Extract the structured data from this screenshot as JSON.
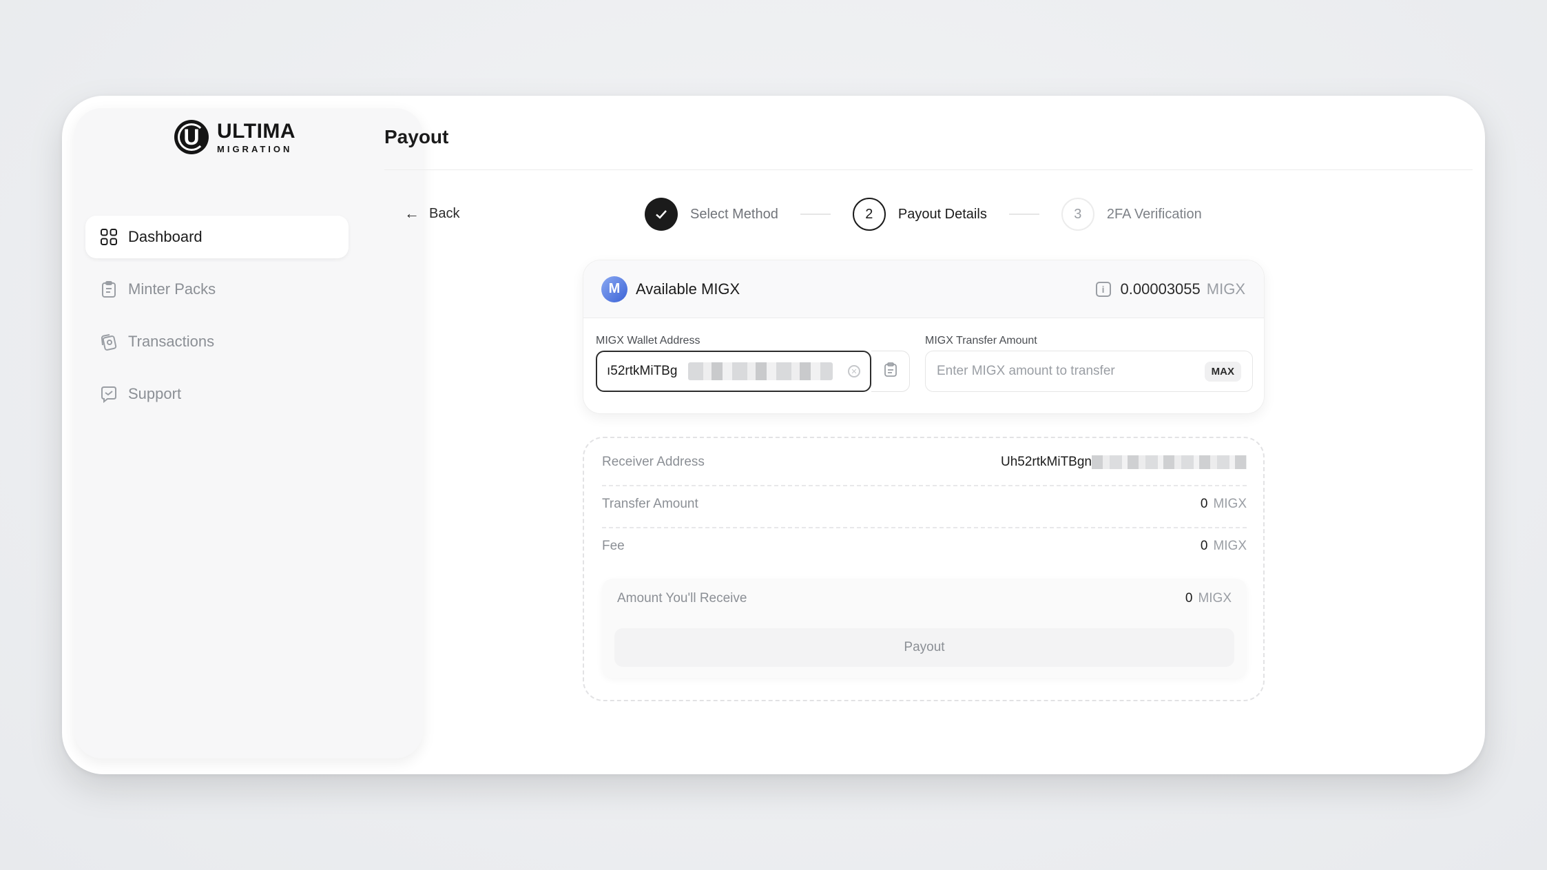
{
  "brand": {
    "title": "ULTIMA",
    "subtitle": "MIGRATION",
    "mark": "U"
  },
  "sidebar": {
    "items": [
      {
        "label": "Dashboard",
        "icon": "grid-icon",
        "active": true
      },
      {
        "label": "Minter Packs",
        "icon": "clipboard-icon",
        "active": false
      },
      {
        "label": "Transactions",
        "icon": "cards-icon",
        "active": false
      },
      {
        "label": "Support",
        "icon": "chat-icon",
        "active": false
      }
    ]
  },
  "header": {
    "title": "Payout"
  },
  "back": {
    "label": "Back",
    "icon": "arrow-left-icon"
  },
  "stepper": {
    "steps": [
      {
        "number": "✓",
        "label": "Select Method",
        "state": "done"
      },
      {
        "number": "2",
        "label": "Payout Details",
        "state": "current"
      },
      {
        "number": "3",
        "label": "2FA Verification",
        "state": "todo"
      }
    ]
  },
  "available": {
    "title": "Available MIGX",
    "logo": "M",
    "value": "0.00003055",
    "unit": "MIGX"
  },
  "wallet": {
    "label": "MIGX Wallet Address",
    "value": "ı52rtkMiTBg"
  },
  "amount": {
    "label": "MIGX Transfer Amount",
    "placeholder": "Enter MIGX amount to transfer",
    "max_label": "MAX"
  },
  "summary": {
    "receiver_label": "Receiver Address",
    "receiver_value": "Uh52rtkMiTBgn",
    "transfer_label": "Transfer Amount",
    "transfer_value": "0",
    "fee_label": "Fee",
    "fee_value": "0",
    "receive_label": "Amount You'll Receive",
    "receive_value": "0",
    "unit": "MIGX",
    "payout_label": "Payout"
  },
  "colors": {
    "accent": "#1b1b1b",
    "migx": "#3b63d6",
    "muted": "#8b8f95"
  }
}
